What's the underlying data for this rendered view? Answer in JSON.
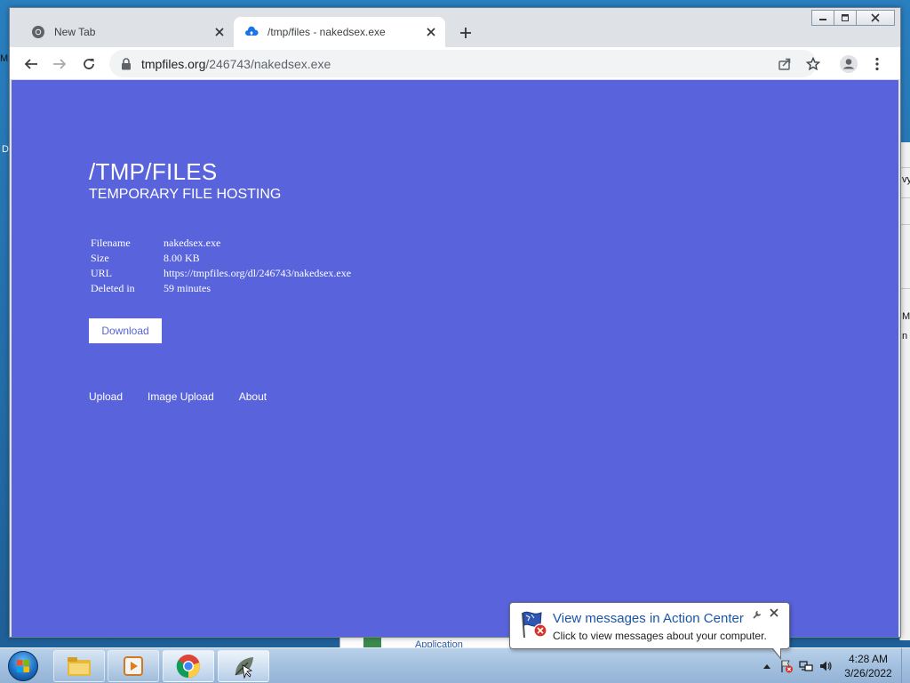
{
  "browser": {
    "tabs": [
      {
        "title": "New Tab",
        "icon": "chrome-icon",
        "active": false
      },
      {
        "title": "/tmp/files - nakedsex.exe",
        "icon": "cloud-upload-icon",
        "active": true
      }
    ],
    "address": {
      "host": "tmpfiles.org",
      "path": "/246743/nakedsex.exe"
    }
  },
  "page": {
    "title": "/TMP/FILES",
    "subtitle": "TEMPORARY FILE HOSTING",
    "file_info": [
      {
        "label": "Filename",
        "value": "nakedsex.exe"
      },
      {
        "label": "Size",
        "value": "8.00 KB"
      },
      {
        "label": "URL",
        "value": "https://tmpfiles.org/dl/246743/nakedsex.exe"
      },
      {
        "label": "Deleted in",
        "value": "59 minutes"
      }
    ],
    "download_label": "Download",
    "footer_links": [
      "Upload",
      "Image Upload",
      "About"
    ],
    "colors": {
      "background": "#5863dc",
      "text": "#ffffff"
    }
  },
  "notification": {
    "title": "View messages in Action Center",
    "text": "Click to view messages about your computer."
  },
  "taskbar": {
    "time": "4:28 AM",
    "date": "3/26/2022",
    "apps": [
      "file-explorer-icon",
      "media-player-icon",
      "chrome-icon",
      "app-leaf-icon"
    ]
  },
  "background": {
    "left_letters": [
      "M",
      "D"
    ],
    "right_letters": [
      "vy",
      "ML",
      "n"
    ],
    "behind_window_text": "Application"
  }
}
